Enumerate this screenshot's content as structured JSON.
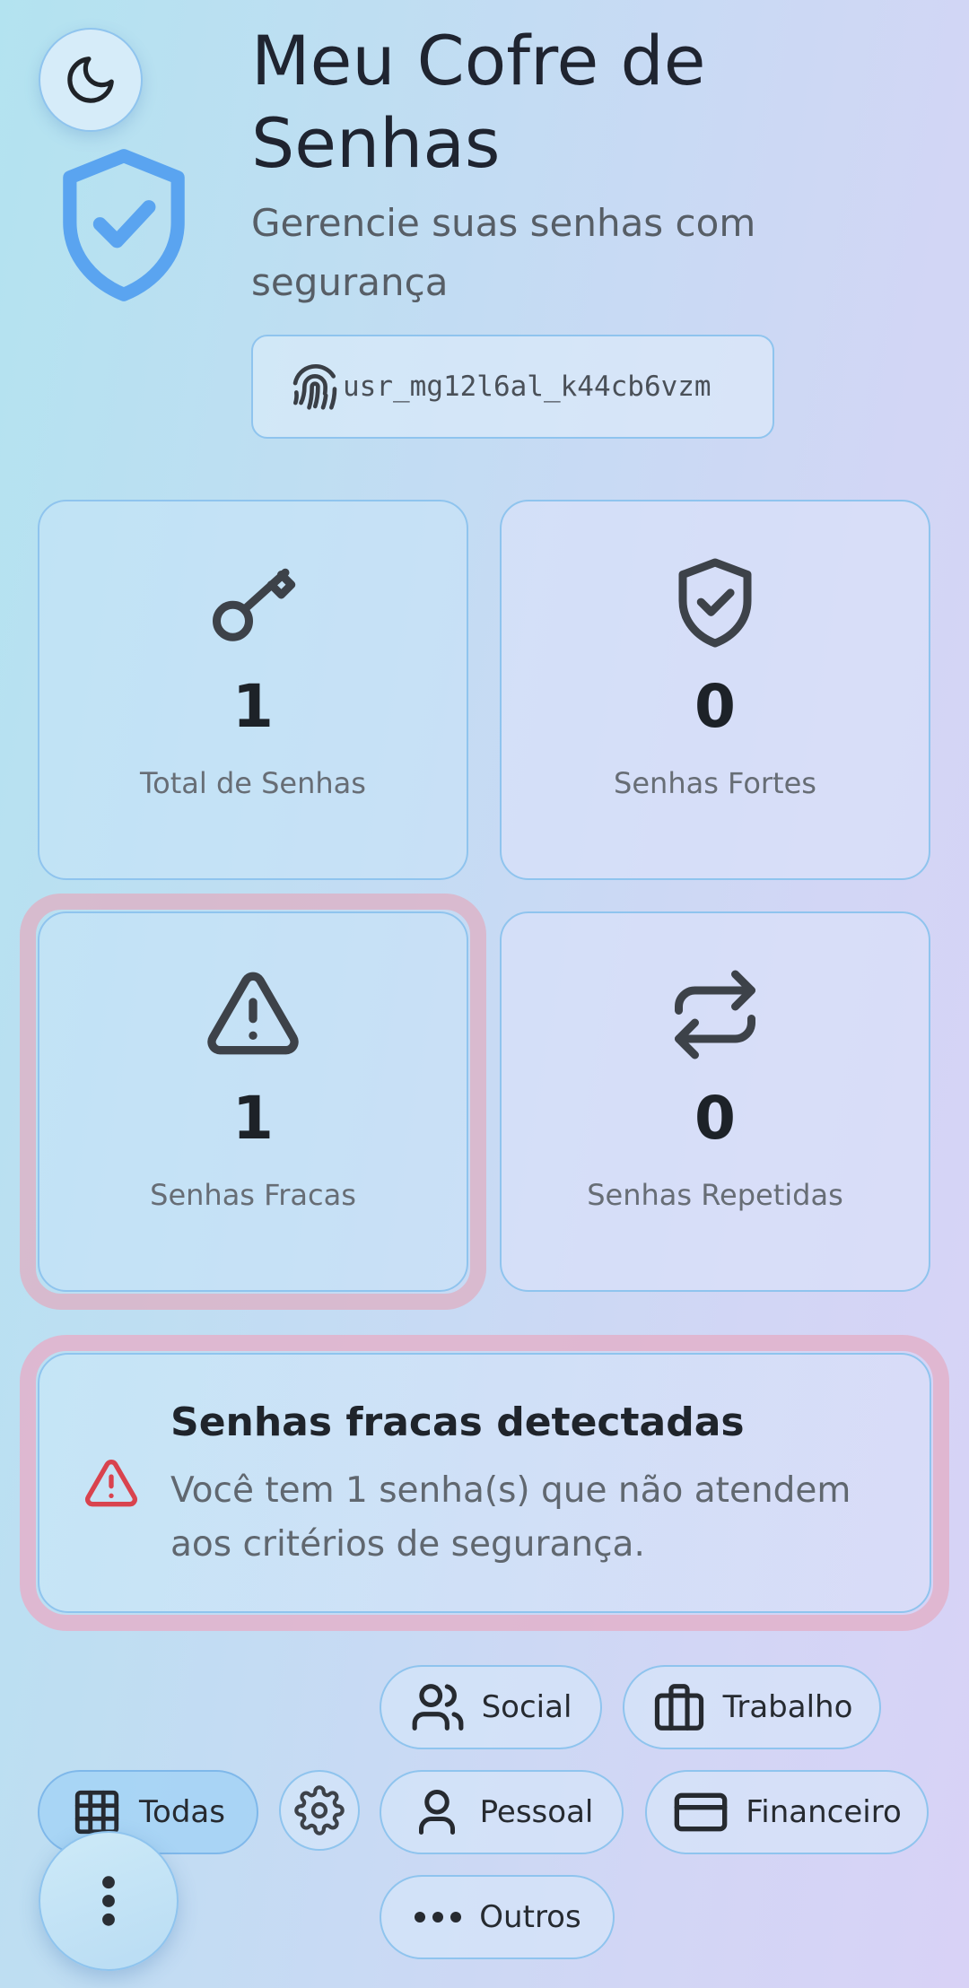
{
  "header": {
    "title": "Meu Cofre de Senhas",
    "subtitle": "Gerencie suas senhas com segurança",
    "user_id": "usr_mg12l6al_k44cb6vzm",
    "icons": [
      "moon-icon",
      "shield-check-icon",
      "fingerprint-icon"
    ]
  },
  "stats": [
    {
      "icon": "key-icon",
      "value": "1",
      "label": "Total de Senhas"
    },
    {
      "icon": "shield-check-icon",
      "value": "0",
      "label": "Senhas Fortes"
    },
    {
      "icon": "warning-icon",
      "value": "1",
      "label": "Senhas Fracas"
    },
    {
      "icon": "repeat-icon",
      "value": "0",
      "label": "Senhas Repetidas"
    }
  ],
  "alert": {
    "icon": "warning-icon",
    "title": "Senhas fracas detectadas",
    "message": "Você tem 1 senha(s) que não atendem aos critérios de segurança."
  },
  "categories": [
    {
      "icon": "users-icon",
      "label": "Social"
    },
    {
      "icon": "briefcase-icon",
      "label": "Trabalho"
    },
    {
      "icon": "grid-icon",
      "label": "Todas",
      "selected": true
    },
    {
      "icon": "user-icon",
      "label": "Pessoal"
    },
    {
      "icon": "credit-card-icon",
      "label": "Financeiro"
    },
    {
      "icon": "dots-icon",
      "label": "Outros"
    }
  ],
  "colors": {
    "accent": "#5aa4f0",
    "danger": "#d9434e",
    "border": "#8fc4ee"
  }
}
